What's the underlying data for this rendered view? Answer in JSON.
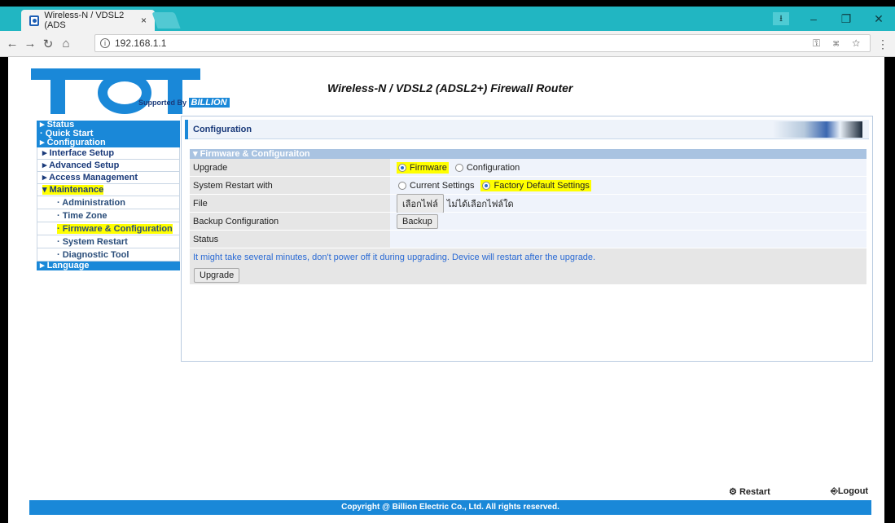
{
  "browser": {
    "tab_title": "Wireless-N / VDSL2 (ADS",
    "tab_close": "×",
    "url": "192.168.1.1",
    "win_controls": [
      "–",
      "❐",
      "✕"
    ],
    "user_badge": "⭳"
  },
  "header": {
    "router_title": "Wireless-N / VDSL2 (ADSL2+) Firewall Router",
    "supported_by": "Supported By",
    "brand": "BILLION"
  },
  "sidebar": {
    "status": "▸ Status",
    "quick_start": "· Quick Start",
    "configuration": "▸ Configuration",
    "interface_setup": "▸ Interface Setup",
    "advanced_setup": "▸ Advanced Setup",
    "access_management": "▸ Access Management",
    "maintenance": "▾ Maintenance",
    "administration": "· Administration",
    "time_zone": "· Time Zone",
    "firmware_configuration": "· Firmware & Configuration",
    "system_restart": "· System Restart",
    "diagnostic_tool": "· Diagnostic Tool",
    "language": "▸ Language"
  },
  "main": {
    "section_title": "Configuration",
    "panel_title": "▾ Firmware & Configuraiton",
    "rows": {
      "upgrade_label": "Upgrade",
      "upgrade_opt1": "Firmware",
      "upgrade_opt2": "Configuration",
      "restart_label": "System Restart with",
      "restart_opt1": "Current Settings",
      "restart_opt2": "Factory Default Settings",
      "file_label": "File",
      "file_button": "เลือกไฟล์",
      "file_status": "ไม่ได้เลือกไฟล์ใด",
      "backup_label": "Backup Configuration",
      "backup_button": "Backup",
      "status_label": "Status",
      "note": "It might take several minutes, don't power off it during upgrading. Device will restart after the upgrade.",
      "upgrade_button": "Upgrade"
    }
  },
  "footer": {
    "restart": "Restart",
    "logout": "Logout",
    "copyright": "Copyright @ Billion Electric Co., Ltd. All rights reserved."
  }
}
